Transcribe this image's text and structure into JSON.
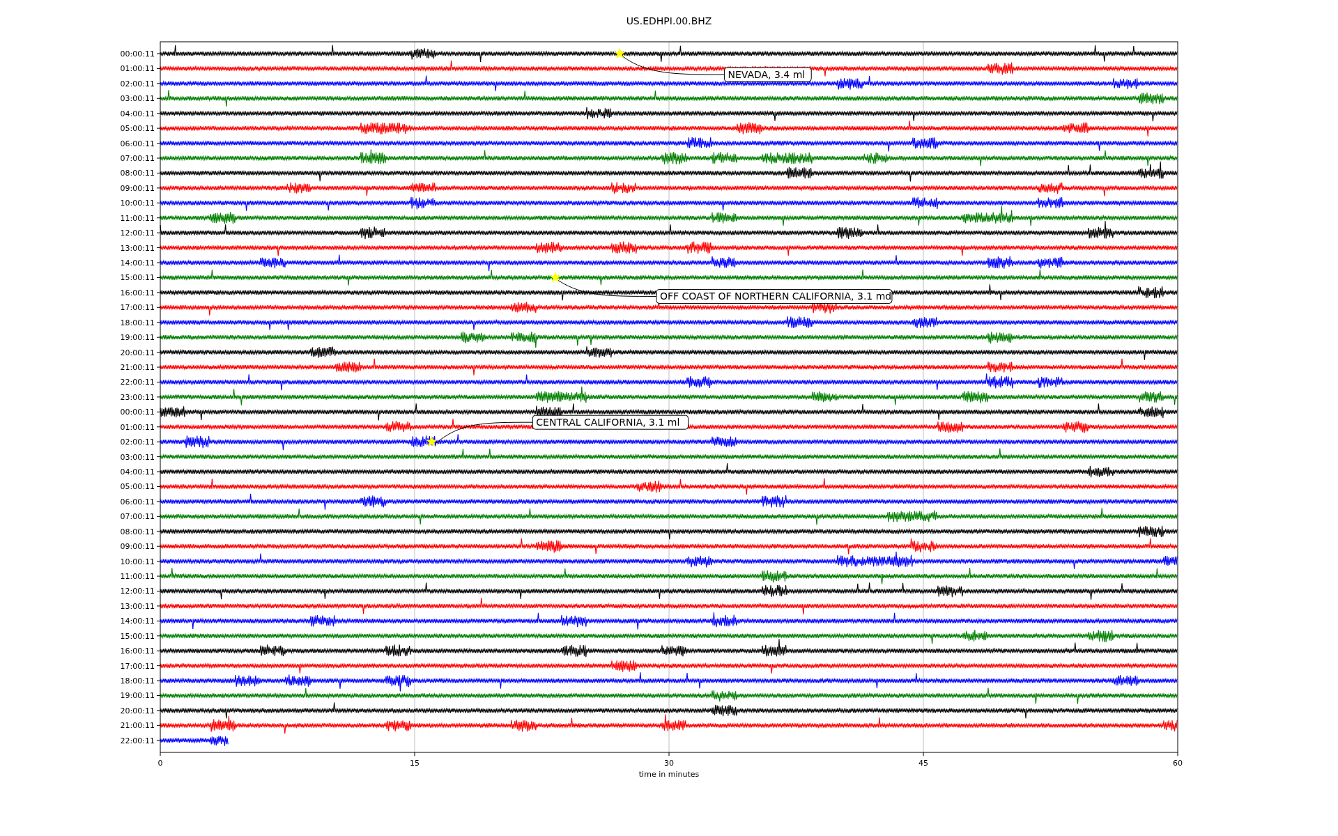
{
  "plot": {
    "title": "US.EDHPI.00.BHZ",
    "xlabel": "time in minutes",
    "xticks": [
      "0",
      "15",
      "30",
      "45",
      "60"
    ],
    "traces": [
      {
        "label": "00:00:11",
        "color": "#000000",
        "level": 1,
        "event": {
          "label": "NEVADA, 3.4 ml"
        }
      },
      {
        "label": "01:00:11",
        "color": "#ff0000",
        "level": 1
      },
      {
        "label": "02:00:11",
        "color": "#0000ff",
        "level": 1
      },
      {
        "label": "03:00:11",
        "color": "#008000",
        "level": 1
      },
      {
        "label": "04:00:11",
        "color": "#000000",
        "level": 1
      },
      {
        "label": "05:00:11",
        "color": "#ff0000",
        "level": 1
      },
      {
        "label": "06:00:11",
        "color": "#0000ff",
        "level": 1
      },
      {
        "label": "07:00:11",
        "color": "#008000",
        "level": 1
      },
      {
        "label": "08:00:11",
        "color": "#000000",
        "level": 1
      },
      {
        "label": "09:00:11",
        "color": "#ff0000",
        "level": 1
      },
      {
        "label": "10:00:11",
        "color": "#0000ff",
        "level": 1
      },
      {
        "label": "11:00:11",
        "color": "#008000",
        "level": 1
      },
      {
        "label": "12:00:11",
        "color": "#000000",
        "level": 1
      },
      {
        "label": "13:00:11",
        "color": "#ff0000",
        "level": 1
      },
      {
        "label": "14:00:11",
        "color": "#0000ff",
        "level": 1
      },
      {
        "label": "15:00:11",
        "color": "#008000",
        "level": 1,
        "event": {
          "label": "OFF COAST OF NORTHERN CALIFORNIA, 3.1 md"
        }
      },
      {
        "label": "16:00:11",
        "color": "#000000",
        "level": 1
      },
      {
        "label": "17:00:11",
        "color": "#ff0000",
        "level": 1
      },
      {
        "label": "18:00:11",
        "color": "#0000ff",
        "level": 1
      },
      {
        "label": "19:00:11",
        "color": "#008000",
        "level": 1
      },
      {
        "label": "20:00:11",
        "color": "#000000",
        "level": 1
      },
      {
        "label": "21:00:11",
        "color": "#ff0000",
        "level": 1
      },
      {
        "label": "22:00:11",
        "color": "#0000ff",
        "level": 1
      },
      {
        "label": "23:00:11",
        "color": "#008000",
        "level": 1
      },
      {
        "label": "00:00:11",
        "color": "#000000",
        "level": 1
      },
      {
        "label": "01:00:11",
        "color": "#ff0000",
        "level": 1
      },
      {
        "label": "02:00:11",
        "color": "#0000ff",
        "level": 1,
        "event": {
          "label": "CENTRAL CALIFORNIA, 3.1 ml"
        }
      },
      {
        "label": "03:00:11",
        "color": "#008000",
        "level": 1
      },
      {
        "label": "04:00:11",
        "color": "#000000",
        "level": 1
      },
      {
        "label": "05:00:11",
        "color": "#ff0000",
        "level": 1
      },
      {
        "label": "06:00:11",
        "color": "#0000ff",
        "level": 1
      },
      {
        "label": "07:00:11",
        "color": "#008000",
        "level": 1
      },
      {
        "label": "08:00:11",
        "color": "#000000",
        "level": 1
      },
      {
        "label": "09:00:11",
        "color": "#ff0000",
        "level": 1
      },
      {
        "label": "10:00:11",
        "color": "#0000ff",
        "level": 1
      },
      {
        "label": "11:00:11",
        "color": "#008000",
        "level": 1
      },
      {
        "label": "12:00:11",
        "color": "#000000",
        "level": 1
      },
      {
        "label": "13:00:11",
        "color": "#ff0000",
        "level": 1
      },
      {
        "label": "14:00:11",
        "color": "#0000ff",
        "level": 1
      },
      {
        "label": "15:00:11",
        "color": "#008000",
        "level": 1
      },
      {
        "label": "16:00:11",
        "color": "#000000",
        "level": 1
      },
      {
        "label": "17:00:11",
        "color": "#ff0000",
        "level": 1
      },
      {
        "label": "18:00:11",
        "color": "#0000ff",
        "level": 1
      },
      {
        "label": "19:00:11",
        "color": "#008000",
        "level": 1
      },
      {
        "label": "20:00:11",
        "color": "#000000",
        "level": 1
      },
      {
        "label": "21:00:11",
        "color": "#ff0000",
        "level": 1
      },
      {
        "label": "22:00:11",
        "color": "#0000ff",
        "level": 0.067
      }
    ]
  }
}
